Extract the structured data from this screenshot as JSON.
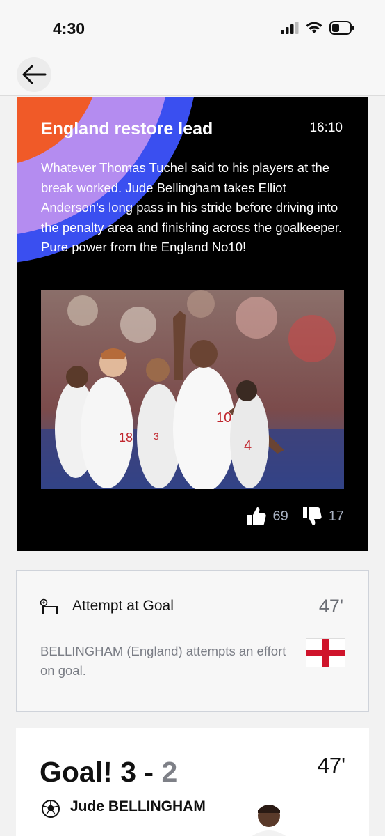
{
  "status_bar": {
    "time": "4:30"
  },
  "nav": {
    "back_icon": "arrow-left-icon"
  },
  "live_update": {
    "title": "England restore lead",
    "time": "16:10",
    "body": "Whatever Thomas Tuchel said to his players at the break worked. Jude Bellingham takes Elliot Anderson's long pass in his stride before driving into the penalty area and finishing across the goalkeeper. Pure power from the England No10!",
    "likes": "69",
    "dislikes": "17"
  },
  "attempt_event": {
    "title": "Attempt at Goal",
    "minute": "47'",
    "description": "BELLINGHAM (England) attempts an effort on goal."
  },
  "goal_event": {
    "label": "Goal!",
    "home_score": "3",
    "separator": "-",
    "away_score": "2",
    "minute": "47'",
    "scorer": "Jude BELLINGHAM"
  },
  "colors": {
    "card_background": "#000000",
    "stripe_orange": "#f05a28",
    "stripe_lavender": "#b48cf0",
    "stripe_blue": "#3a4ff0",
    "muted_text": "#7a7d85",
    "flag_red": "#cf142b"
  }
}
